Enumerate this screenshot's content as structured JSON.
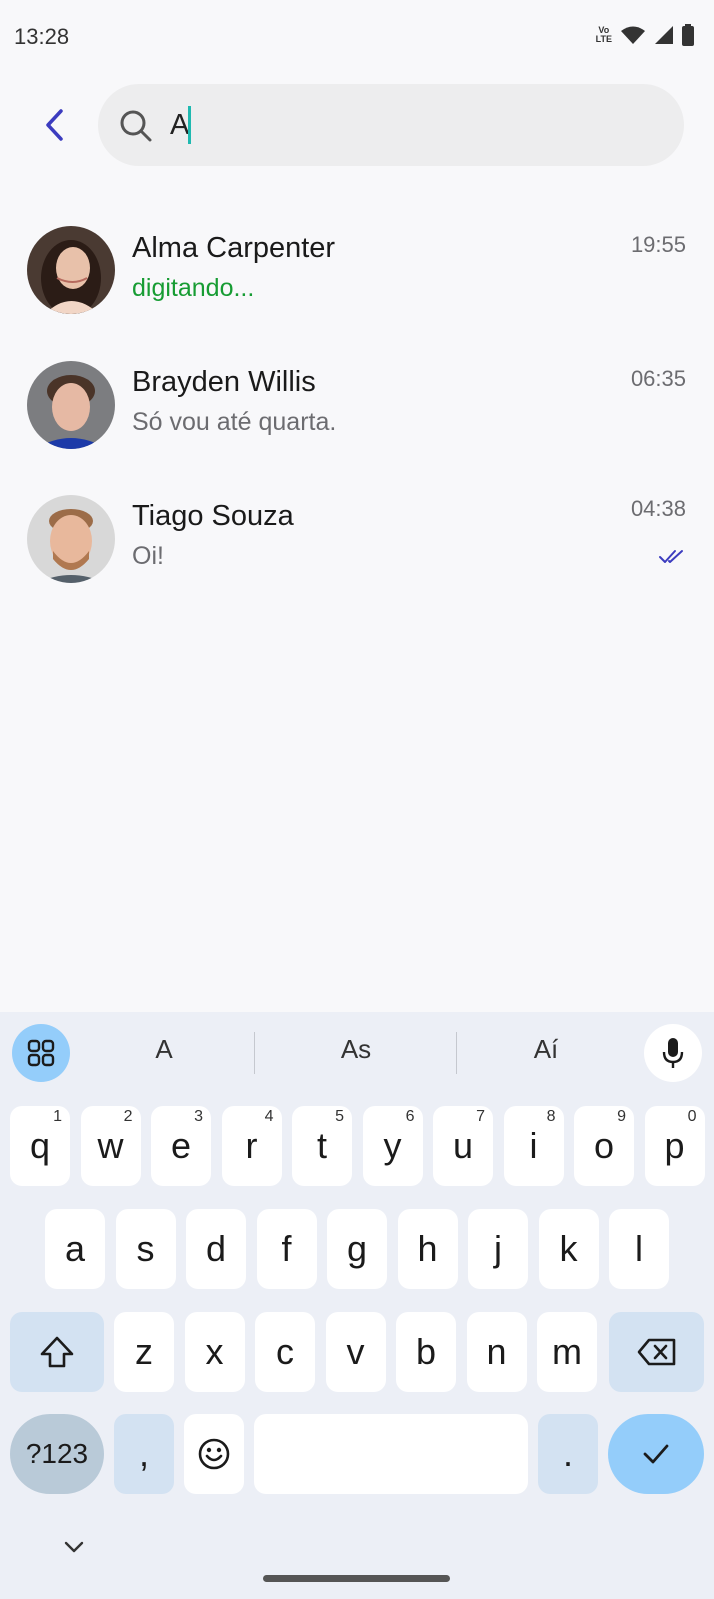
{
  "status": {
    "time": "13:28",
    "volte": [
      "Vo",
      "LTE"
    ]
  },
  "search": {
    "query": "A"
  },
  "chats": [
    {
      "name": "Alma Carpenter",
      "message": "digitando...",
      "time": "19:55",
      "typing": true
    },
    {
      "name": "Brayden Willis",
      "message": "Só vou até quarta.",
      "time": "06:35",
      "typing": false
    },
    {
      "name": "Tiago Souza",
      "message": "Oi!",
      "time": "04:38",
      "typing": false,
      "read": true
    }
  ],
  "keyboard": {
    "suggestions": [
      "A",
      "As",
      "Aí"
    ],
    "row1": [
      {
        "k": "q",
        "h": "1"
      },
      {
        "k": "w",
        "h": "2"
      },
      {
        "k": "e",
        "h": "3"
      },
      {
        "k": "r",
        "h": "4"
      },
      {
        "k": "t",
        "h": "5"
      },
      {
        "k": "y",
        "h": "6"
      },
      {
        "k": "u",
        "h": "7"
      },
      {
        "k": "i",
        "h": "8"
      },
      {
        "k": "o",
        "h": "9"
      },
      {
        "k": "p",
        "h": "0"
      }
    ],
    "row2": [
      "a",
      "s",
      "d",
      "f",
      "g",
      "h",
      "j",
      "k",
      "l"
    ],
    "row3": [
      "z",
      "x",
      "c",
      "v",
      "b",
      "n",
      "m"
    ],
    "sym_label": "?123",
    "comma": ",",
    "period": "."
  },
  "icons": {
    "back": "back-arrow-icon",
    "search": "search-icon",
    "read": "double-check-icon",
    "grid": "grid-icon",
    "mic": "mic-icon",
    "shift": "shift-icon",
    "backspace": "backspace-icon",
    "emoji": "emoji-icon",
    "enter": "check-icon",
    "hide": "chevron-down-icon"
  },
  "colors": {
    "accent": "#3c3cbf",
    "typing": "#179c33",
    "caret": "#1fb9b0"
  }
}
